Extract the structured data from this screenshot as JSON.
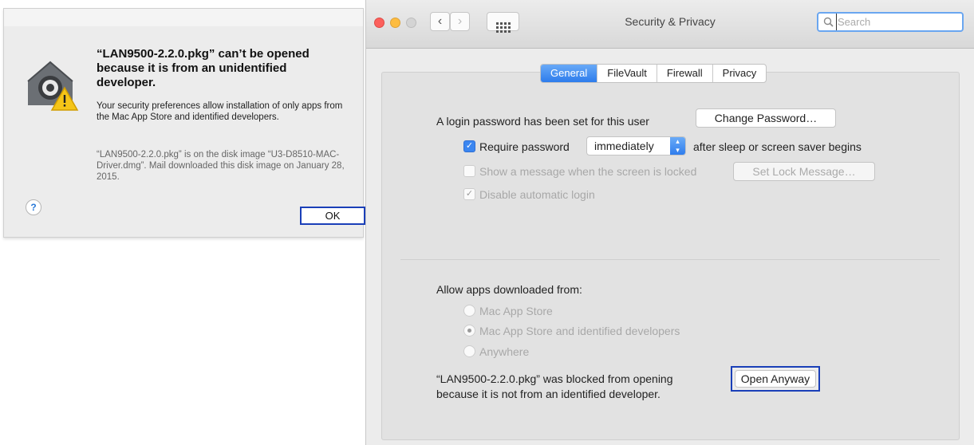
{
  "alert": {
    "title": "“LAN9500-2.2.0.pkg” can’t be opened because it is from an unidentified developer.",
    "body": "Your security preferences allow installation of only apps from the Mac App Store and identified developers.",
    "note": "“LAN9500-2.2.0.pkg” is on the disk image “U3-D8510-MAC-Driver.dmg”. Mail downloaded this disk image on January 28, 2015.",
    "help_label": "?",
    "ok_label": "OK",
    "icon": "gatekeeper-warning-icon"
  },
  "window": {
    "title": "Security & Privacy",
    "search_placeholder": "Search",
    "traffic_lights": [
      "#fc605c",
      "#fdbc40",
      "#d4d4d4"
    ]
  },
  "tabs": [
    {
      "label": "General",
      "active": true
    },
    {
      "label": "FileVault",
      "active": false
    },
    {
      "label": "Firewall",
      "active": false
    },
    {
      "label": "Privacy",
      "active": false
    }
  ],
  "general": {
    "password_text": "A login password has been set for this user",
    "change_password_label": "Change Password…",
    "require_password": {
      "checked": true,
      "label": "Require password",
      "select_value": "immediately",
      "suffix": "after sleep or screen saver begins"
    },
    "show_message": {
      "checked": false,
      "label": "Show a message when the screen is locked",
      "button_label": "Set Lock Message…"
    },
    "disable_autologin": {
      "checked": true,
      "label": "Disable automatic login"
    }
  },
  "allow_apps": {
    "heading": "Allow apps downloaded from:",
    "options": [
      {
        "label": "Mac App Store",
        "selected": false
      },
      {
        "label": "Mac App Store and identified developers",
        "selected": true
      },
      {
        "label": "Anywhere",
        "selected": false
      }
    ],
    "blocked_message": "“LAN9500-2.2.0.pkg” was blocked from opening because it is not from an identified developer.",
    "open_anyway_label": "Open Anyway"
  },
  "accent_color": "#1a3fb8"
}
